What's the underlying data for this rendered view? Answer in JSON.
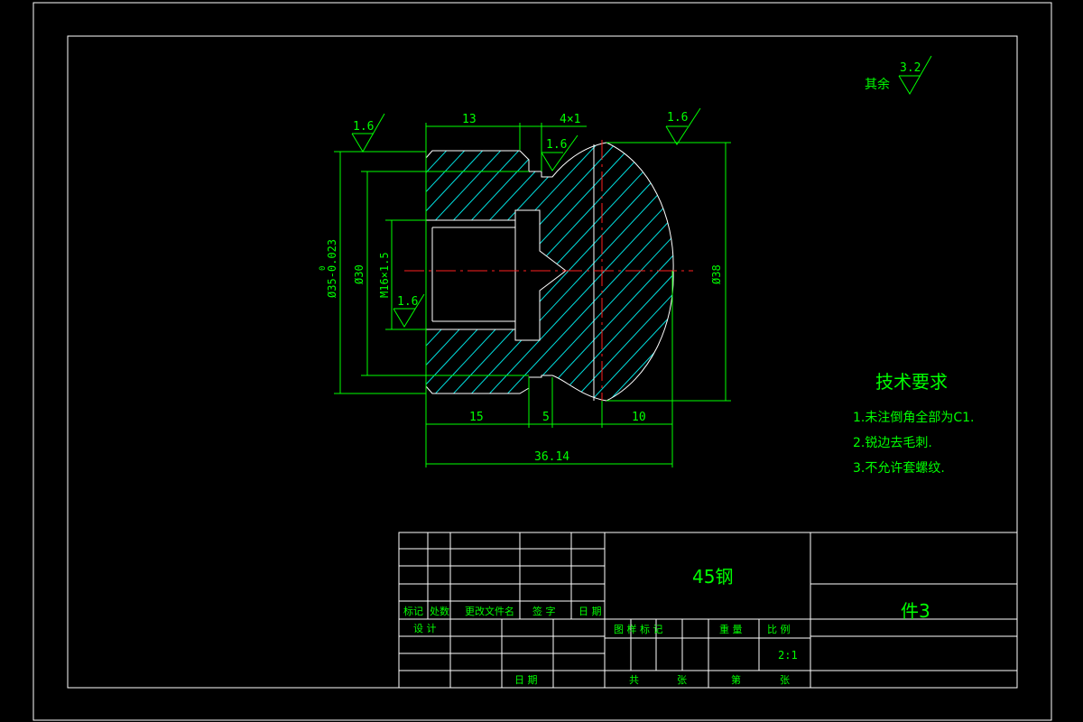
{
  "surface_finish": {
    "rest_label": "其余",
    "rest_value": "3.2",
    "left_top": "1.6",
    "right_top": "1.6",
    "groove": "1.6",
    "bore": "1.6"
  },
  "dimensions": {
    "top_length": "13",
    "chamfer": "4×1",
    "outer_dia": "Ø35-0.023",
    "outer_dia_tol": "0",
    "inner_dia": "Ø30",
    "thread": "M16×1.5",
    "head_dia": "Ø38",
    "bottom_left": "15",
    "bottom_mid": "5",
    "bottom_right": "10",
    "overall": "36.14"
  },
  "tech_requirements": {
    "title": "技术要求",
    "items": [
      "1.未注倒角全部为C1.",
      "2.锐边去毛刺.",
      "3.不允许套螺纹."
    ]
  },
  "title_block": {
    "material": "45钢",
    "part_name": "件3",
    "scale": "2:1",
    "labels": {
      "mark": "标记",
      "count": "处数",
      "change_doc": "更改文件名",
      "signature": "签 字",
      "date": "日 期",
      "design": "设 计",
      "stage_mark": "图 样 标 记",
      "weight": "重 量",
      "ratio": "比 例",
      "date2": "日 期",
      "total": "共",
      "sheets": "张",
      "sheet_no": "第",
      "sheets2": "张"
    }
  },
  "colors": {
    "background": "#000000",
    "lines": "#ffffff",
    "dimensions": "#00ff00",
    "hatch": "#00e0e0",
    "centerline": "#ff2020"
  }
}
